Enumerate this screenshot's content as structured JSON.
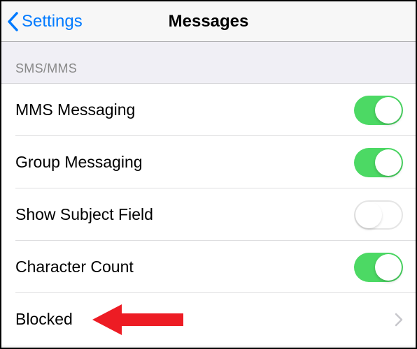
{
  "header": {
    "back_label": "Settings",
    "title": "Messages"
  },
  "section": {
    "label": "SMS/MMS"
  },
  "rows": {
    "mms": {
      "label": "MMS Messaging",
      "on": true
    },
    "group": {
      "label": "Group Messaging",
      "on": true
    },
    "subject": {
      "label": "Show Subject Field",
      "on": false
    },
    "charcount": {
      "label": "Character Count",
      "on": true
    },
    "blocked": {
      "label": "Blocked"
    }
  },
  "colors": {
    "accent": "#007aff",
    "toggle_on": "#4cd964",
    "arrow": "#ed1c24"
  }
}
